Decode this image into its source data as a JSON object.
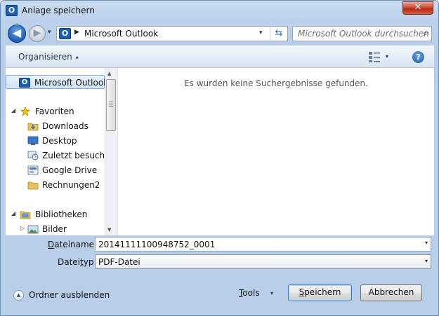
{
  "window": {
    "title": "Anlage speichern",
    "close_glyph": "✕",
    "app_icon_letter": "O"
  },
  "navigation": {
    "back_glyph": "◀",
    "forward_glyph": "▶",
    "history_glyph": "▾",
    "address": {
      "icon_letter": "O",
      "separator": "▶",
      "location": "Microsoft Outlook",
      "dropdown_glyph": "▾",
      "refresh_glyph": "⇆"
    },
    "search": {
      "placeholder": "Microsoft Outlook durchsuchen",
      "icon_glyph": "⌕"
    }
  },
  "command_bar": {
    "organize_label": "Organisieren",
    "organize_arrow": "▾",
    "views_arrow": "▾",
    "help_glyph": "?"
  },
  "nav_pane": {
    "items": [
      {
        "label": "Microsoft Outlook",
        "icon": "outlook-icon",
        "selected": true
      },
      {
        "label": "Favoriten",
        "icon": "star-icon",
        "expander": "◢"
      },
      {
        "label": "Downloads",
        "icon": "downloads-folder-icon"
      },
      {
        "label": "Desktop",
        "icon": "desktop-icon"
      },
      {
        "label": "Zuletzt besucht",
        "icon": "recent-places-icon"
      },
      {
        "label": "Google Drive",
        "icon": "google-drive-icon"
      },
      {
        "label": "Rechnungen2",
        "icon": "folder-icon"
      },
      {
        "label": "Bibliotheken",
        "icon": "libraries-icon",
        "expander": "◢"
      },
      {
        "label": "Bilder",
        "icon": "pictures-icon",
        "expander": "▷"
      }
    ],
    "scroll_up_glyph": "▲",
    "scroll_down_glyph": "▼"
  },
  "results": {
    "empty_message": "Es wurden keine Suchergebnisse gefunden."
  },
  "form": {
    "filename_label_key": "D",
    "filename_label_rest": "ateiname:",
    "filename_value": "20141111100948752_0001",
    "filetype_label_pre": "Datei",
    "filetype_label_key": "t",
    "filetype_label_post": "yp:",
    "filetype_value": "PDF-Datei",
    "dropdown_glyph": "▾"
  },
  "footer": {
    "hide_folders_label": "Ordner ausblenden",
    "hide_glyph": "▲",
    "tools_key": "T",
    "tools_rest": "ools",
    "tools_arrow": "▾",
    "save_key": "S",
    "save_rest": "peichern",
    "cancel_label": "Abbrechen"
  },
  "colors": {
    "accent": "#1a5fb4",
    "selection": "#cfe3fb",
    "close_button": "#cc4b35"
  }
}
